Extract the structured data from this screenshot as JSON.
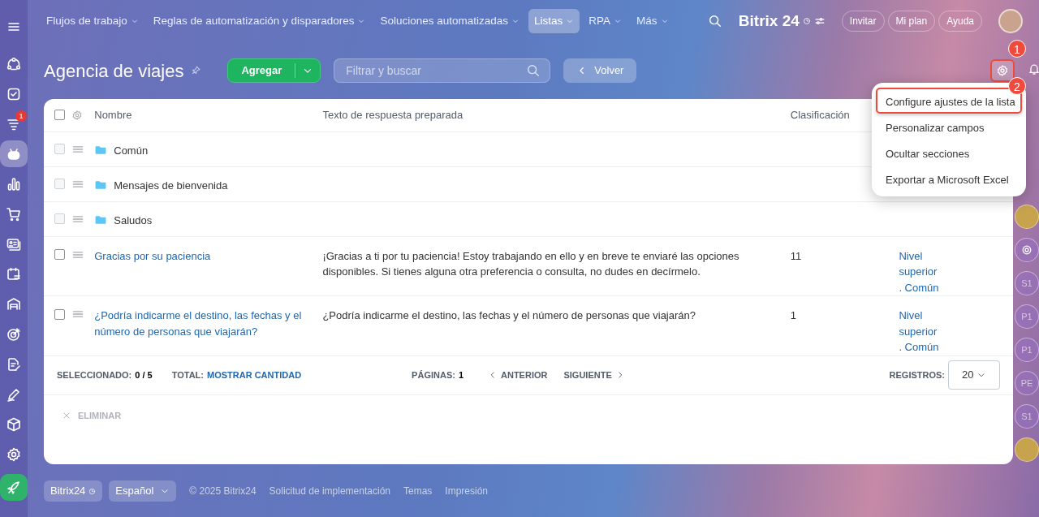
{
  "sidebar": {
    "items": [
      {
        "selected": false
      },
      {
        "selected": false
      },
      {
        "selected": false,
        "badge": "1"
      },
      {
        "selected": true
      },
      {
        "selected": false
      },
      {
        "selected": false
      },
      {
        "selected": false
      },
      {
        "selected": false
      },
      {
        "selected": false
      },
      {
        "selected": false
      },
      {
        "selected": false
      },
      {
        "selected": false
      },
      {
        "selected": false
      },
      {
        "selected": false
      },
      {
        "selected": false
      }
    ]
  },
  "top_nav": {
    "items": [
      {
        "label": "Flujos de trabajo",
        "selected": false
      },
      {
        "label": "Reglas de automatización y disparadores",
        "selected": false
      },
      {
        "label": "Soluciones automatizadas",
        "selected": false
      },
      {
        "label": "Listas",
        "selected": true
      },
      {
        "label": "RPA",
        "selected": false
      },
      {
        "label": "Más",
        "selected": false
      }
    ],
    "logo": "Bitrix 24",
    "buttons": [
      "Invitar",
      "Mi plan",
      "Ayuda"
    ]
  },
  "header": {
    "title": "Agencia de viajes",
    "add_button": "Agregar",
    "search": {
      "placeholder": "Filtrar y buscar"
    },
    "back_button": "Volver",
    "settings_callout": "1"
  },
  "table": {
    "header_checked": false,
    "columns": [
      "Nombre",
      "Texto de respuesta preparada",
      "Clasificación"
    ],
    "rows": [
      {
        "kind": "folder",
        "name": "Común",
        "checked": false,
        "disabled": true
      },
      {
        "kind": "folder",
        "name": "Mensajes de bienvenida",
        "checked": false,
        "disabled": true
      },
      {
        "kind": "folder",
        "name": "Saludos",
        "checked": false,
        "disabled": true
      },
      {
        "kind": "item",
        "name": "Gracias por su paciencia",
        "text": "¡Gracias a ti por tu paciencia! Estoy trabajando en ello y en breve te enviaré las opciones disponibles. Si tienes alguna otra preferencia o consulta, no dudes en decírmelo.",
        "rank": "11",
        "column_4": "Nivel superior . Común",
        "checked": false,
        "disabled": false
      },
      {
        "kind": "item",
        "name": "¿Podría indicarme el destino, las fechas y el número de personas que viajarán?",
        "text": "¿Podría indicarme el destino, las fechas y el número de personas que viajarán?",
        "rank": "1",
        "column_4": "Nivel superior . Común",
        "checked": false,
        "disabled": false
      }
    ],
    "footer": {
      "selected_label": "SELECCIONADO:",
      "selected_value": "0 / 5",
      "total_label": "TOTAL:",
      "total_link": "MOSTRAR CANTIDAD",
      "pages_label": "PÁGINAS:",
      "pages_value": "1",
      "prev": "ANTERIOR",
      "next": "SIGUIENTE",
      "records_label": "REGISTROS:",
      "records_value": "20"
    },
    "actions": [
      {
        "label": "ELIMINAR",
        "disabled": true
      }
    ]
  },
  "menu": {
    "callout": "2",
    "items": [
      {
        "label": "Configure ajustes de la lista",
        "highlighted": true
      },
      {
        "label": "Personalizar campos",
        "highlighted": false
      },
      {
        "label": "Ocultar secciones",
        "highlighted": false
      },
      {
        "label": "Exportar a Microsoft Excel",
        "highlighted": false
      }
    ]
  },
  "right_rail": [
    {
      "kind": "photo"
    },
    {
      "kind": "icon"
    },
    {
      "kind": "initials",
      "text": "S1"
    },
    {
      "kind": "initials",
      "text": "P1"
    },
    {
      "kind": "initials",
      "text": "P1"
    },
    {
      "kind": "initials",
      "text": "PE"
    },
    {
      "kind": "initials",
      "text": "S1"
    },
    {
      "kind": "photo"
    }
  ],
  "footer": {
    "brand": "Bitrix24",
    "language": "Español",
    "copyright": "© 2025 Bitrix24",
    "links": [
      "Solicitud de implementación",
      "Temas",
      "Impresión"
    ]
  }
}
